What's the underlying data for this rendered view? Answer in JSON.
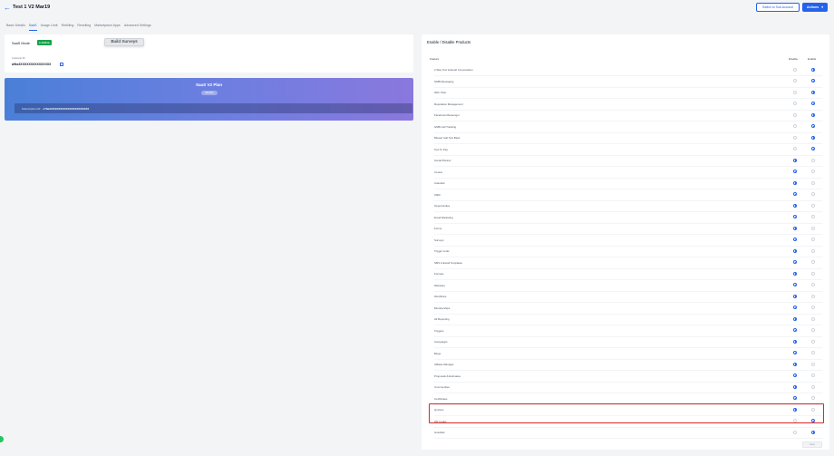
{
  "header": {
    "title": "Test 1 V2 Mar19",
    "switch_label": "Switch to Sub-Account",
    "actions_label": "Actions"
  },
  "tabs": [
    "Basic Details",
    "SaaS",
    "Usage Limit",
    "Rebilling",
    "Reselling",
    "Marketplace Apps",
    "Advanced Settings"
  ],
  "saas": {
    "mode_label": "SaaS Mode",
    "status": "● Active",
    "tooltip": "Build Surveys",
    "customer_label": "Customer ID",
    "customer_id": "a9kx3XXXXXXXXXXXXXXX"
  },
  "plan": {
    "name": "SaaS V2 Plan",
    "pill": "Monthly",
    "subscription_label": "Subscription ID:",
    "subscription_id": "sY9aXXXXXXXXXXXXXXXXXXXXXX"
  },
  "products": {
    "title": "Enable / Disable Products",
    "feature_header": "Feature",
    "disable_header": "Disable",
    "enable_header": "Enable",
    "rows": [
      {
        "label": "2 Way Text & Email Conversation",
        "enabled": true
      },
      {
        "label": "GMB Messaging",
        "enabled": true
      },
      {
        "label": "Web Chat",
        "enabled": true
      },
      {
        "label": "Reputation Management",
        "enabled": true
      },
      {
        "label": "Facebook Messenger",
        "enabled": true
      },
      {
        "label": "GMB Call Tracking",
        "enabled": true
      },
      {
        "label": "Missed Call Text Back",
        "enabled": true
      },
      {
        "label": "Text To Pay",
        "enabled": true
      },
      {
        "label": "Social Planner",
        "enabled": false
      },
      {
        "label": "Invoice",
        "enabled": false
      },
      {
        "label": "Calendar",
        "enabled": false
      },
      {
        "label": "CRM",
        "enabled": false
      },
      {
        "label": "Opportunities",
        "enabled": false
      },
      {
        "label": "Email Marketing",
        "enabled": false
      },
      {
        "label": "Forms",
        "enabled": false
      },
      {
        "label": "Surveys",
        "enabled": false
      },
      {
        "label": "Trigger Links",
        "enabled": false
      },
      {
        "label": "SMS & Email Templates",
        "enabled": false
      },
      {
        "label": "Funnels",
        "enabled": false
      },
      {
        "label": "Websites",
        "enabled": false
      },
      {
        "label": "Workflows",
        "enabled": false
      },
      {
        "label": "Memberships",
        "enabled": false
      },
      {
        "label": "All Reporting",
        "enabled": false
      },
      {
        "label": "Triggers",
        "enabled": false
      },
      {
        "label": "Campaigns",
        "enabled": false
      },
      {
        "label": "Blogs",
        "enabled": false
      },
      {
        "label": "Affiliate Manager",
        "enabled": false
      },
      {
        "label": "Proposals & Estimates",
        "enabled": false
      },
      {
        "label": "Communities",
        "enabled": false
      },
      {
        "label": "Certificates",
        "enabled": false
      },
      {
        "label": "Quizzes",
        "enabled": false
      },
      {
        "label": "QR Codes",
        "enabled": true
      },
      {
        "label": "Gokollab",
        "enabled": true
      }
    ],
    "save_label": "Save"
  }
}
